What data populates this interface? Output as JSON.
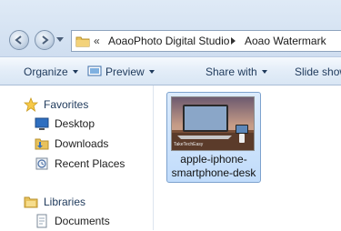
{
  "address": {
    "overflow": "«",
    "crumbs": [
      "AoaoPhoto Digital Studio",
      "Aoao Watermark"
    ]
  },
  "toolbar": {
    "organize": "Organize",
    "preview": "Preview",
    "share": "Share with",
    "slideshow": "Slide show"
  },
  "nav": {
    "favorites": "Favorites",
    "desktop": "Desktop",
    "downloads": "Downloads",
    "recent": "Recent Places",
    "libraries": "Libraries",
    "documents": "Documents"
  },
  "file": {
    "name": "apple-iphone-smartphone-desk",
    "thumb_caption": "TakeTechEasy"
  },
  "colors": {
    "accent": "#1e395b",
    "selection": "#c1dcfb"
  }
}
